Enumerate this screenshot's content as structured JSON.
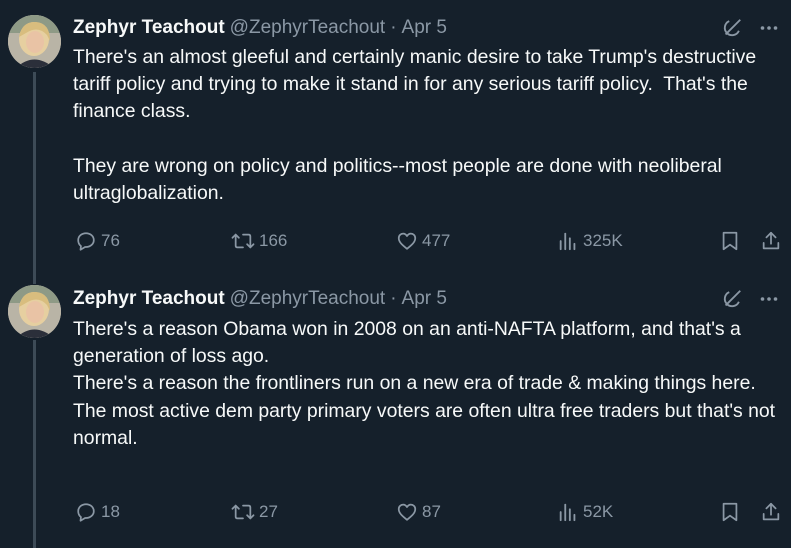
{
  "tweets": [
    {
      "author": {
        "name": "Zephyr Teachout",
        "handle": "@ZephyrTeachout"
      },
      "separator": "·",
      "date": "Apr 5",
      "paragraphs": [
        "There's an almost gleeful and certainly manic desire to take Trump's destructive tariff policy and trying to make it stand in for any serious tariff policy.  That's the finance class.",
        "They are wrong on policy and politics--most people are done with neoliberal ultraglobalization."
      ],
      "stats": {
        "replies": "76",
        "reposts": "166",
        "likes": "477",
        "views": "325K"
      }
    },
    {
      "author": {
        "name": "Zephyr Teachout",
        "handle": "@ZephyrTeachout"
      },
      "separator": "·",
      "date": "Apr 5",
      "paragraphs": [
        "There's a reason Obama won in 2008 on an anti-NAFTA platform, and that's a generation of loss ago.",
        "There's a reason the frontliners run on a new era of trade & making things here.",
        "The most active dem party primary voters are often ultra free traders but that's not normal."
      ],
      "stats": {
        "replies": "18",
        "reposts": "27",
        "likes": "87",
        "views": "52K"
      }
    }
  ],
  "icons": {
    "reply": "reply-icon",
    "repost": "repost-icon",
    "like": "heart-icon",
    "views": "views-icon",
    "bookmark": "bookmark-icon",
    "share": "share-icon",
    "grok": "grok-icon",
    "more": "more-icon"
  },
  "colors": {
    "background": "#15202b",
    "text": "#f7f9f9",
    "muted": "#8b98a5",
    "thread_line": "#3d4b57"
  }
}
